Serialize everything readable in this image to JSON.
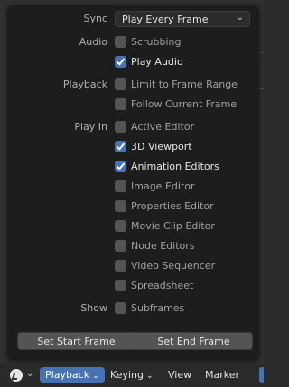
{
  "popup": {
    "sync": {
      "label": "Sync",
      "value": "Play Every Frame",
      "icon": "chevron-down-icon"
    },
    "rows": [
      {
        "section": "Audio",
        "label": "Scrubbing",
        "checked": false
      },
      {
        "section": "",
        "label": "Play Audio",
        "checked": true
      },
      {
        "section": "Playback",
        "label": "Limit to Frame Range",
        "checked": false
      },
      {
        "section": "",
        "label": "Follow Current Frame",
        "checked": false
      },
      {
        "section": "Play In",
        "label": "Active Editor",
        "checked": false
      },
      {
        "section": "",
        "label": "3D Viewport",
        "checked": true
      },
      {
        "section": "",
        "label": "Animation Editors",
        "checked": true
      },
      {
        "section": "",
        "label": "Image Editor",
        "checked": false
      },
      {
        "section": "",
        "label": "Properties Editor",
        "checked": false
      },
      {
        "section": "",
        "label": "Movie Clip Editor",
        "checked": false
      },
      {
        "section": "",
        "label": "Node Editors",
        "checked": false
      },
      {
        "section": "",
        "label": "Video Sequencer",
        "checked": false
      },
      {
        "section": "",
        "label": "Spreadsheet",
        "checked": false
      },
      {
        "section": "Show",
        "label": "Subframes",
        "checked": false
      }
    ],
    "buttons": {
      "set_start": "Set Start Frame",
      "set_end": "Set End Frame"
    }
  },
  "header": {
    "editor_type_icon": "clock-icon",
    "menus": {
      "playback": "Playback",
      "keying": "Keying",
      "view": "View",
      "marker": "Marker"
    }
  },
  "colors": {
    "accent": "#4772b3",
    "popup_bg": "#1d1d1d",
    "checkbox_off": "#545454"
  }
}
